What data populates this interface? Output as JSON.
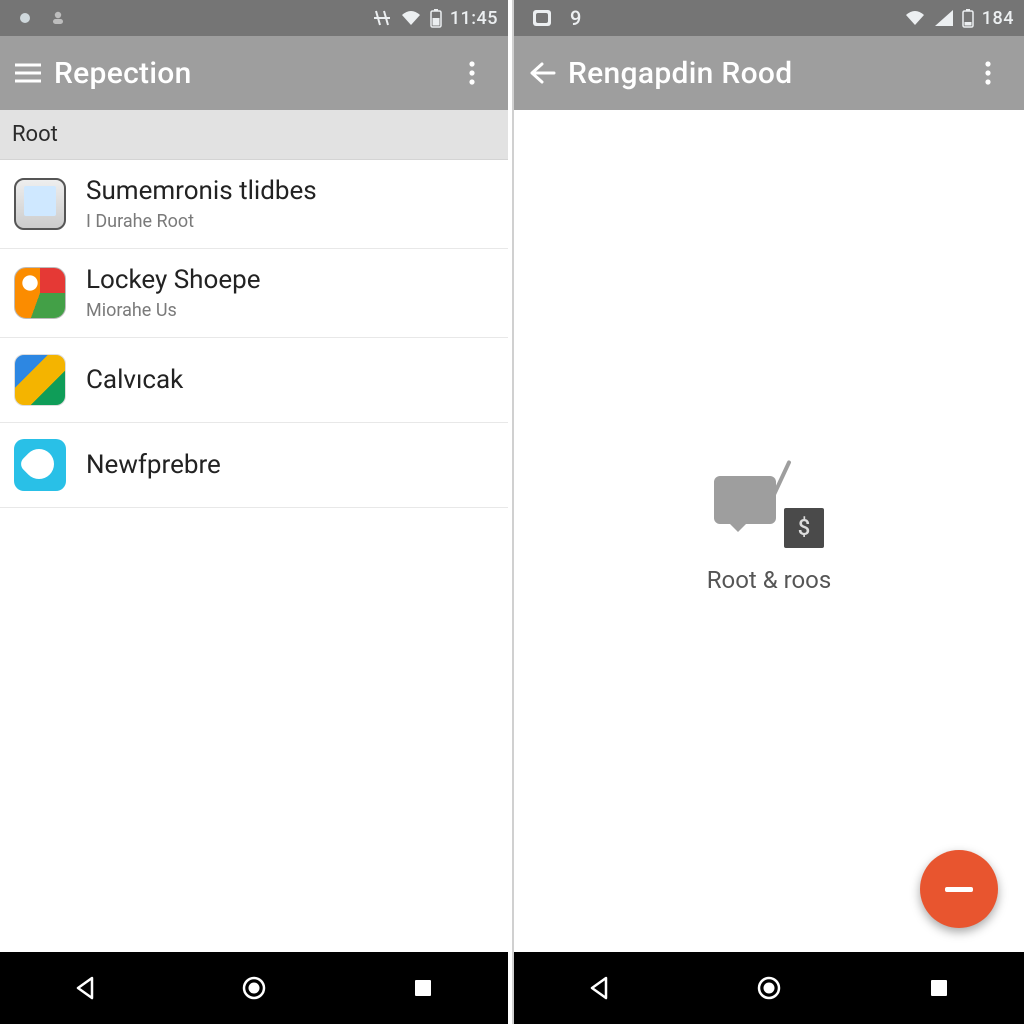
{
  "left": {
    "status": {
      "time": "11:45"
    },
    "toolbar": {
      "title": "Repection"
    },
    "section": {
      "label": "Root"
    },
    "items": [
      {
        "title": "Sumemronis tlidbes",
        "subtitle": "I Durahe Root"
      },
      {
        "title": "Lockey Shoepe",
        "subtitle": "Miorahe Us"
      },
      {
        "title": "Calvıcak",
        "subtitle": ""
      },
      {
        "title": "Newfprebre",
        "subtitle": ""
      }
    ]
  },
  "right": {
    "status": {
      "notif": "9",
      "time": "184"
    },
    "toolbar": {
      "title": "Rengapdin Rood"
    },
    "empty": {
      "label": "Root & roos",
      "badge": "$"
    }
  },
  "colors": {
    "accent": "#e8552f",
    "toolbar": "#9e9e9e",
    "status": "#757575"
  }
}
